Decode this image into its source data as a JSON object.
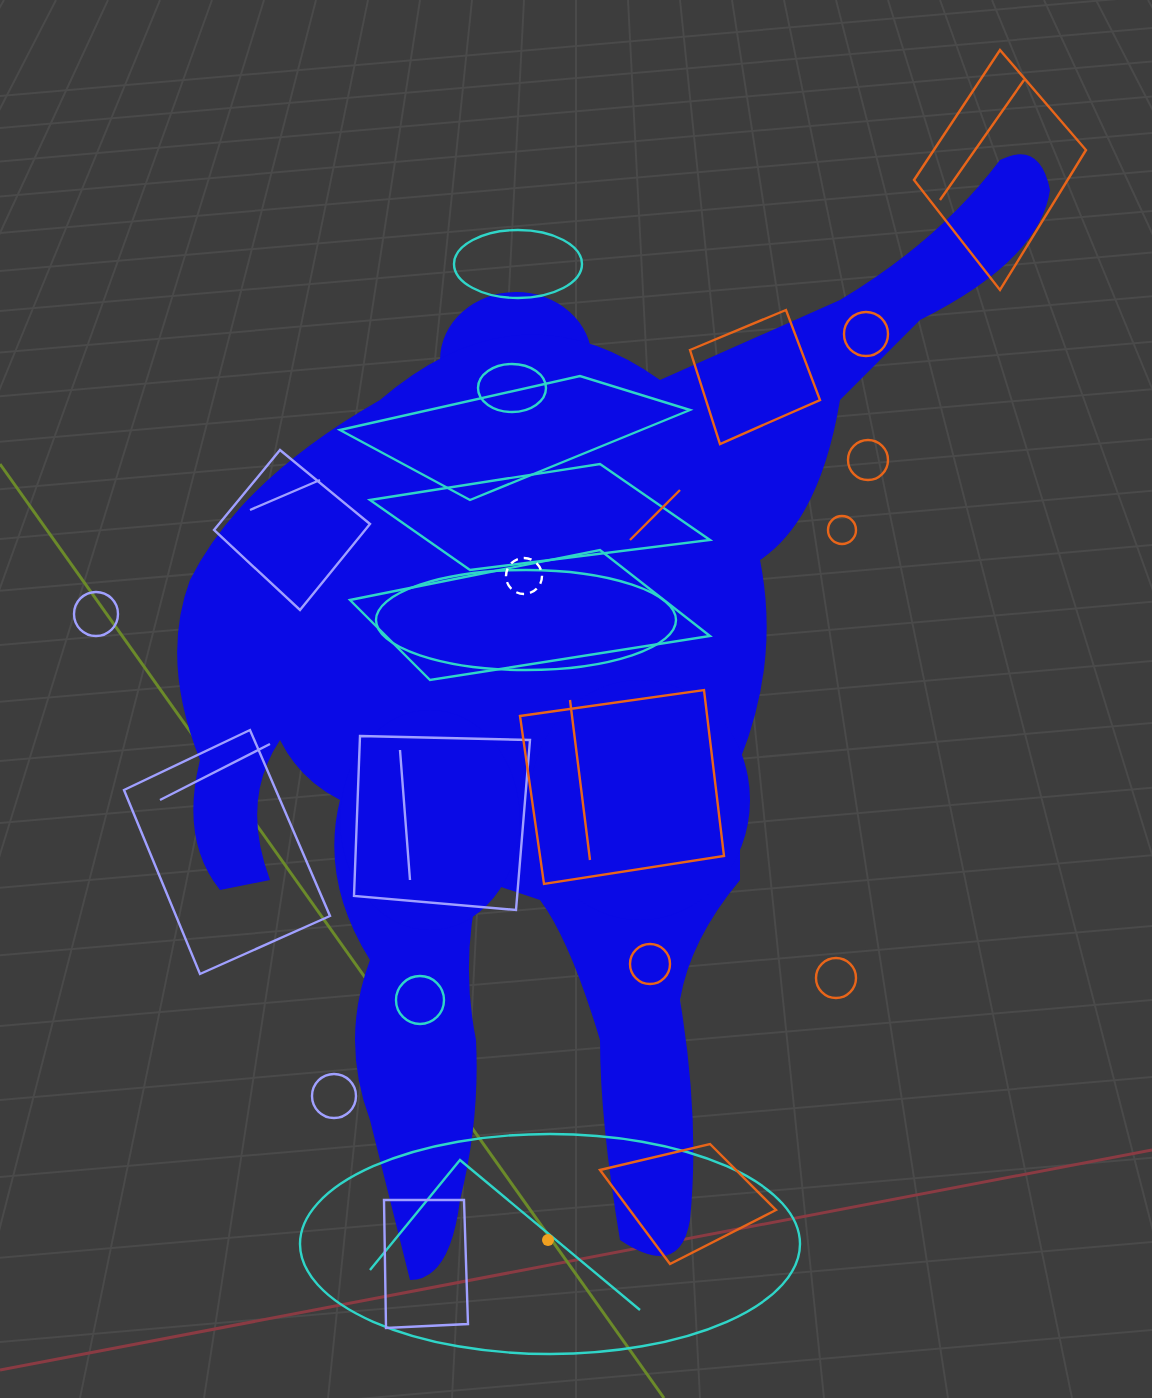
{
  "viewport": {
    "show_grid": true,
    "show_axes": true,
    "show_overlays": true
  }
}
